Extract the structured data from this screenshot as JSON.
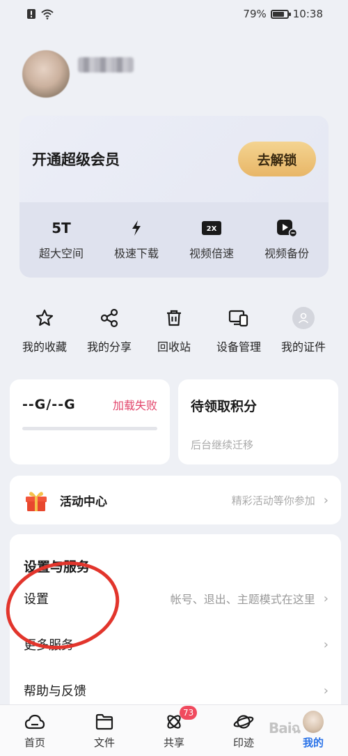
{
  "status_bar": {
    "battery": "79%",
    "battery_level": 0.79,
    "time": "10:38"
  },
  "vip": {
    "title": "开通超级会员",
    "unlock_label": "去解锁",
    "features": [
      {
        "icon": "5T",
        "label": "超大空间"
      },
      {
        "icon": "lightning-icon",
        "label": "极速下载"
      },
      {
        "icon": "speed-2x-icon",
        "label": "视频倍速"
      },
      {
        "icon": "video-backup-icon",
        "label": "视频备份"
      }
    ]
  },
  "quick_actions": [
    {
      "icon": "star-icon",
      "label": "我的收藏"
    },
    {
      "icon": "share-icon",
      "label": "我的分享"
    },
    {
      "icon": "trash-icon",
      "label": "回收站"
    },
    {
      "icon": "devices-icon",
      "label": "设备管理"
    },
    {
      "icon": "id-card-icon",
      "label": "我的证件"
    }
  ],
  "storage": {
    "value": "--G/--G",
    "status": "加载失败"
  },
  "points": {
    "title": "待领取积分",
    "subtitle": "后台继续迁移"
  },
  "activity": {
    "title": "活动中心",
    "subtitle": "精彩活动等你参加"
  },
  "settings_section": {
    "title": "设置与服务",
    "rows": [
      {
        "label": "设置",
        "hint": "帐号、退出、主题模式在这里"
      },
      {
        "label": "更多服务",
        "hint": ""
      },
      {
        "label": "帮助与反馈",
        "hint": ""
      }
    ]
  },
  "tab_bar": {
    "tabs": [
      {
        "icon": "home-cloud-icon",
        "label": "首页"
      },
      {
        "icon": "folder-icon",
        "label": "文件"
      },
      {
        "icon": "share-atom-icon",
        "label": "共享",
        "badge": "73"
      },
      {
        "icon": "planet-icon",
        "label": "印迹"
      },
      {
        "icon": "avatar-icon",
        "label": "我的"
      }
    ],
    "active": "我的"
  },
  "colors": {
    "accent_blue": "#2a73e8",
    "error_pink": "#e2456b",
    "gold": "#e8b667",
    "annotation_red": "#e2352c"
  }
}
